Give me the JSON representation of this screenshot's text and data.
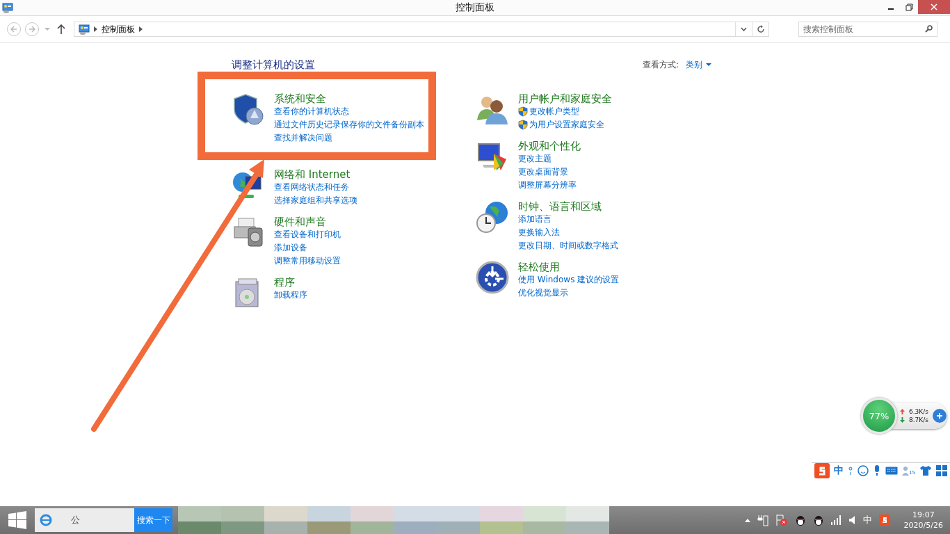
{
  "window": {
    "title": "控制面板"
  },
  "nav": {
    "breadcrumb": [
      "控制面板"
    ],
    "search": {
      "placeholder": "搜索控制面板"
    }
  },
  "page": {
    "heading": "调整计算机的设置",
    "view_by": {
      "label": "查看方式:",
      "value": "类别"
    }
  },
  "columns": [
    [
      {
        "kind": "security",
        "title": "系统和安全",
        "highlighted": true,
        "links": [
          {
            "text": "查看你的计算机状态",
            "shield": false
          },
          {
            "text": "通过文件历史记录保存你的文件备份副本",
            "shield": false
          },
          {
            "text": "查找并解决问题",
            "shield": false
          }
        ]
      },
      {
        "kind": "network",
        "title": "网络和 Internet",
        "highlighted": false,
        "links": [
          {
            "text": "查看网络状态和任务",
            "shield": false
          },
          {
            "text": "选择家庭组和共享选项",
            "shield": false
          }
        ]
      },
      {
        "kind": "hardware",
        "title": "硬件和声音",
        "highlighted": false,
        "links": [
          {
            "text": "查看设备和打印机",
            "shield": false
          },
          {
            "text": "添加设备",
            "shield": false
          },
          {
            "text": "调整常用移动设置",
            "shield": false
          }
        ]
      },
      {
        "kind": "programs",
        "title": "程序",
        "highlighted": false,
        "links": [
          {
            "text": "卸载程序",
            "shield": false
          }
        ]
      }
    ],
    [
      {
        "kind": "users",
        "title": "用户帐户和家庭安全",
        "highlighted": false,
        "links": [
          {
            "text": "更改帐户类型",
            "shield": true
          },
          {
            "text": "为用户设置家庭安全",
            "shield": true
          }
        ]
      },
      {
        "kind": "appearance",
        "title": "外观和个性化",
        "highlighted": false,
        "links": [
          {
            "text": "更改主题",
            "shield": false
          },
          {
            "text": "更改桌面背景",
            "shield": false
          },
          {
            "text": "调整屏幕分辨率",
            "shield": false
          }
        ]
      },
      {
        "kind": "clock",
        "title": "时钟、语言和区域",
        "highlighted": false,
        "links": [
          {
            "text": "添加语言",
            "shield": false
          },
          {
            "text": "更换输入法",
            "shield": false
          },
          {
            "text": "更改日期、时间或数字格式",
            "shield": false
          }
        ]
      },
      {
        "kind": "ease",
        "title": "轻松使用",
        "highlighted": false,
        "links": [
          {
            "text": "使用 Windows 建议的设置",
            "shield": false
          },
          {
            "text": "优化视觉显示",
            "shield": false
          }
        ]
      }
    ]
  ],
  "speed_widget": {
    "percent": "77%",
    "up": "6.3K/s",
    "down": "8.7K/s"
  },
  "ime_bar": {
    "mode": "中",
    "badge": "15"
  },
  "taskbar": {
    "search": {
      "value": "公",
      "button": "搜索一下"
    },
    "tray": {
      "ime": "中",
      "time": "19:07",
      "date": "2020/5/26"
    }
  }
}
